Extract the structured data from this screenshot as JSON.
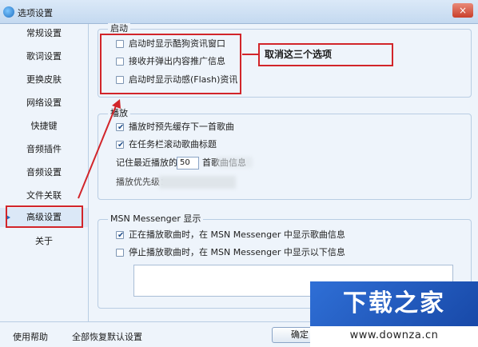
{
  "window": {
    "title": "选项设置",
    "close_glyph": "×"
  },
  "sidebar": {
    "items": [
      {
        "label": "常规设置"
      },
      {
        "label": "歌词设置"
      },
      {
        "label": "更换皮肤"
      },
      {
        "label": "网络设置"
      },
      {
        "label": "快捷键"
      },
      {
        "label": "音频插件"
      },
      {
        "label": "音频设置"
      },
      {
        "label": "文件关联"
      },
      {
        "label": "高级设置",
        "active": true
      },
      {
        "label": "关于"
      }
    ]
  },
  "groups": {
    "startup": {
      "title": "启动",
      "options": [
        {
          "label": "启动时显示酷狗资讯窗口",
          "checked": false
        },
        {
          "label": "接收并弹出内容推广信息",
          "checked": false
        },
        {
          "label": "启动时显示动感(Flash)资讯",
          "checked": false
        }
      ]
    },
    "playback": {
      "title": "播放",
      "options": [
        {
          "label": "播放时预先缓存下一首歌曲",
          "checked": true
        },
        {
          "label": "在任务栏滚动歌曲标题",
          "checked": true
        }
      ],
      "recent_prefix": "记住最近播放的",
      "recent_value": "50",
      "recent_suffix": "首歌曲信息",
      "priority_label": "播放优先级："
    },
    "msn": {
      "title": "MSN Messenger 显示",
      "options": [
        {
          "label": "正在播放歌曲时，在 MSN Messenger 中显示歌曲信息",
          "checked": true
        },
        {
          "label": "停止播放歌曲时，在 MSN Messenger 中显示以下信息",
          "checked": false
        }
      ]
    }
  },
  "annotation": {
    "callout_text": "取消这三个选项",
    "color": "#d2252a"
  },
  "bottom": {
    "help_label": "使用帮助",
    "restore_label": "全部恢复默认设置",
    "ok_label": "确定"
  },
  "watermark": {
    "main": "下载之家",
    "url": "www.downza.cn"
  },
  "colors": {
    "accent": "#1f6fc1",
    "panel_bg": "#eef4fb",
    "border": "#b9cde3",
    "highlight": "#d2252a"
  },
  "icons": [
    "app-icon",
    "close-icon",
    "check-icon",
    "active-arrow-icon"
  ]
}
